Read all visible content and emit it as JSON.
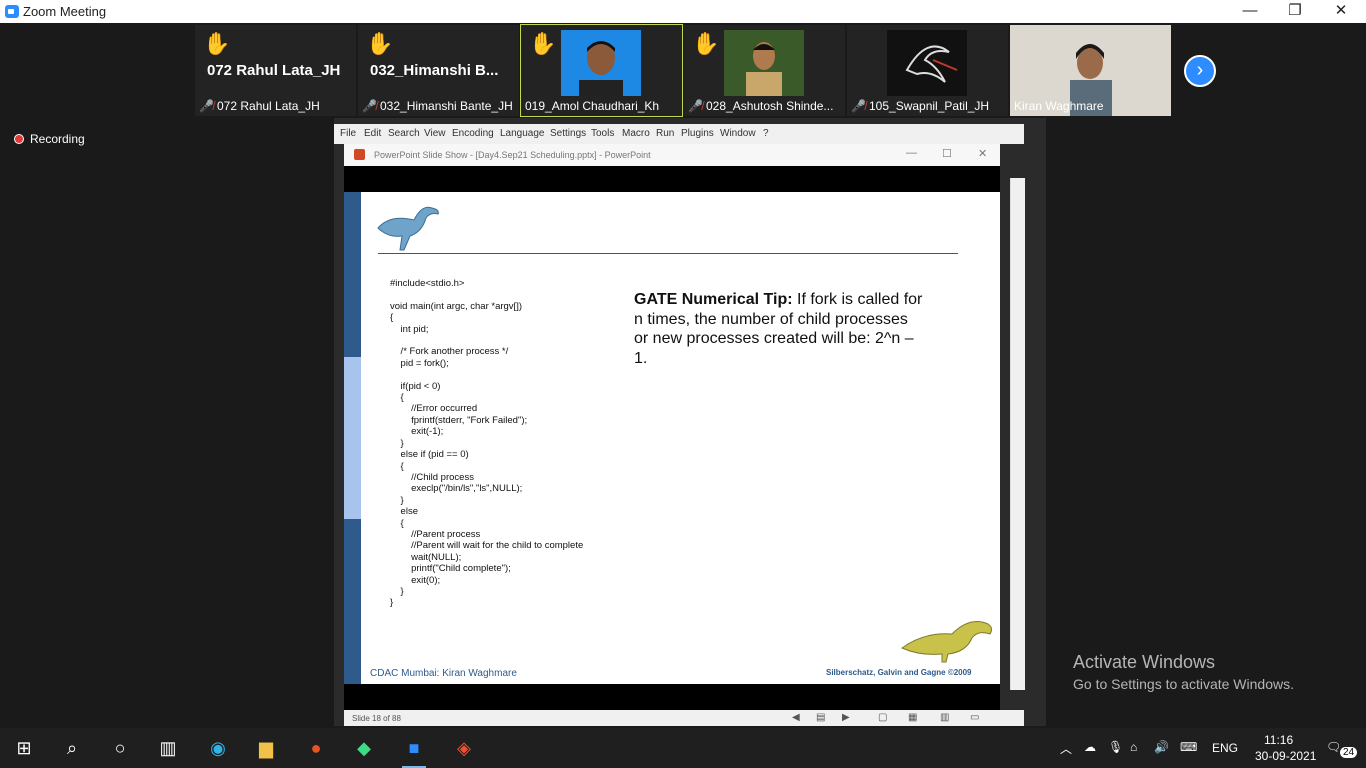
{
  "window": {
    "title": "Zoom Meeting",
    "minimize": "—",
    "maximize": "❐",
    "close": "✕"
  },
  "participants": [
    {
      "name": "072 Rahul Lata_JH",
      "display": "072 Rahul Lata_JH",
      "hand": "✋",
      "video": false
    },
    {
      "name": "032_Himanshi Bante_JH",
      "display": "032_Himanshi  B...",
      "hand": "✋",
      "video": false
    },
    {
      "name": "019_Amol Chaudhari_Kh",
      "hand": "✋",
      "video": true
    },
    {
      "name": "028_Ashutosh Shinde...",
      "hand": "✋",
      "video": true
    },
    {
      "name": "105_Swapnil_Patil_JH",
      "video": true
    },
    {
      "name": "Kiran Waghmare",
      "video": true
    }
  ],
  "recording": {
    "label": "Recording"
  },
  "shared_screen": {
    "notepad_menu": [
      "File",
      "Edit",
      "Search",
      "View",
      "Encoding",
      "Language",
      "Settings",
      "Tools",
      "Macro",
      "Run",
      "Plugins",
      "Window",
      "?"
    ],
    "ppt_window_title": "PowerPoint Slide Show - [Day4.Sep21 Scheduling.pptx] - PowerPoint",
    "slide": {
      "code": "#include<stdio.h>\n\nvoid main(int argc, char *argv[])\n{\n    int pid;\n\n    /* Fork another process */\n    pid = fork();\n\n    if(pid < 0)\n    {\n        //Error occurred\n        fprintf(stderr, \"Fork Failed\");\n        exit(-1);\n    }\n    else if (pid == 0)\n    {\n        //Child process\n        execlp(\"/bin/ls\",\"ls\",NULL);\n    }\n    else\n    {\n        //Parent process\n        //Parent will wait for the child to complete\n        wait(NULL);\n        printf(\"Child complete\");\n        exit(0);\n    }\n}",
      "tip_heading": "GATE Numerical Tip:",
      "tip_body": " If fork is called for n times, the number of child processes or new processes created will be: 2^n – 1.",
      "footer_left": "CDAC Mumbai: Kiran Waghmare",
      "footer_right": "Silberschatz, Galvin and Gagne ©2009"
    },
    "status": "Slide 18 of 88"
  },
  "activate": {
    "title": "Activate Windows",
    "subtitle": "Go to Settings to activate Windows."
  },
  "taskbar": {
    "apps": [
      "start-icon",
      "search-icon",
      "cortana-icon",
      "task-view-icon",
      "edge-icon",
      "file-explorer-icon",
      "ubuntu-icon",
      "android-studio-icon",
      "zoom-icon",
      "git-icon"
    ],
    "language": "ENG",
    "time": "11:16",
    "date": "30-09-2021",
    "notifications": "24"
  }
}
